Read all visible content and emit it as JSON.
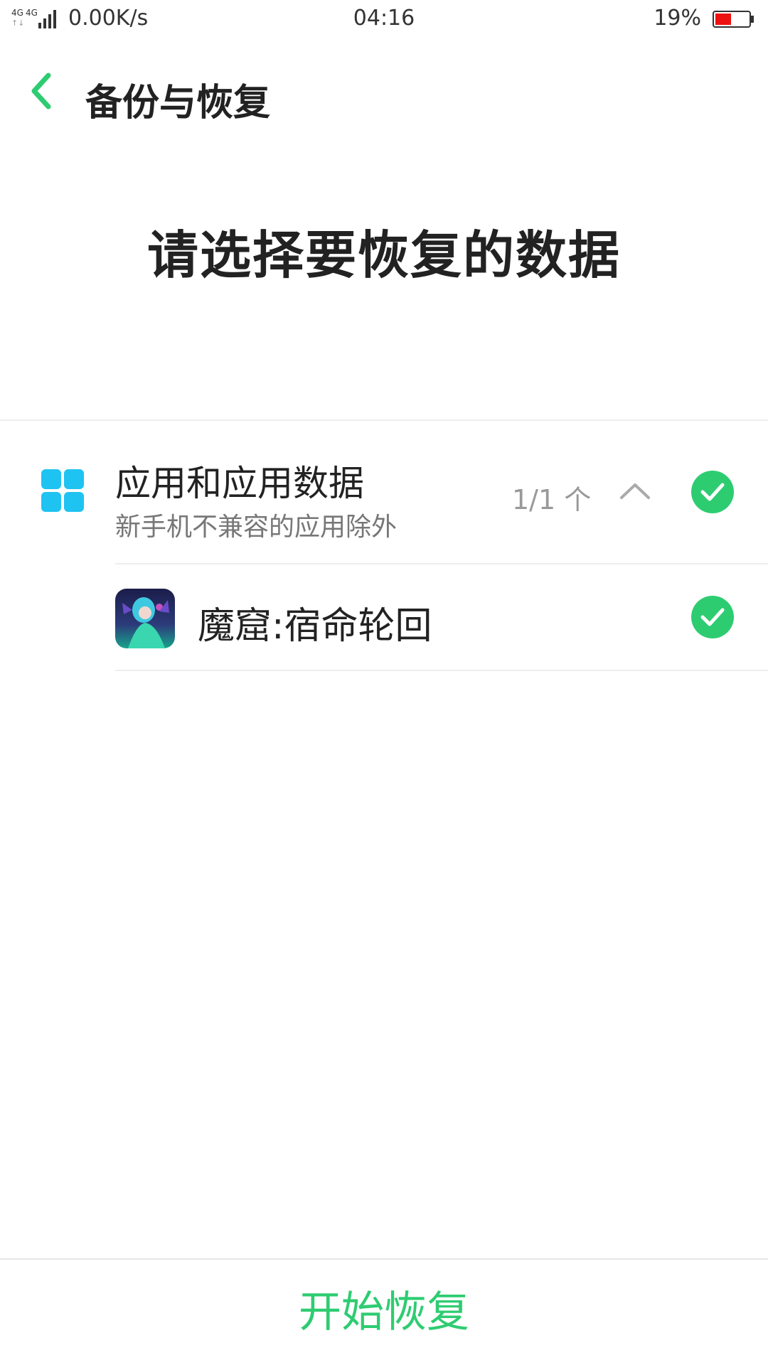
{
  "status_bar": {
    "network_type": "4G 4G",
    "net_speed": "0.00K/s",
    "time": "04:16",
    "battery_percent": "19%",
    "battery_level": 0.19,
    "battery_color": "#ee1111"
  },
  "header": {
    "back_icon": "chevron-left-icon",
    "title": "备份与恢复"
  },
  "headline": "请选择要恢复的数据",
  "category": {
    "icon": "apps-grid-icon",
    "title": "应用和应用数据",
    "subtitle": "新手机不兼容的应用除外",
    "count": "1/1 个",
    "expand_icon": "chevron-up-icon",
    "selected": true
  },
  "apps": [
    {
      "name": "魔窟:宿命轮回",
      "icon": "game-app-icon",
      "selected": true
    }
  ],
  "footer": {
    "start_label": "开始恢复"
  },
  "colors": {
    "accent": "#2ecc71",
    "icon_blue": "#1fc3f1"
  }
}
